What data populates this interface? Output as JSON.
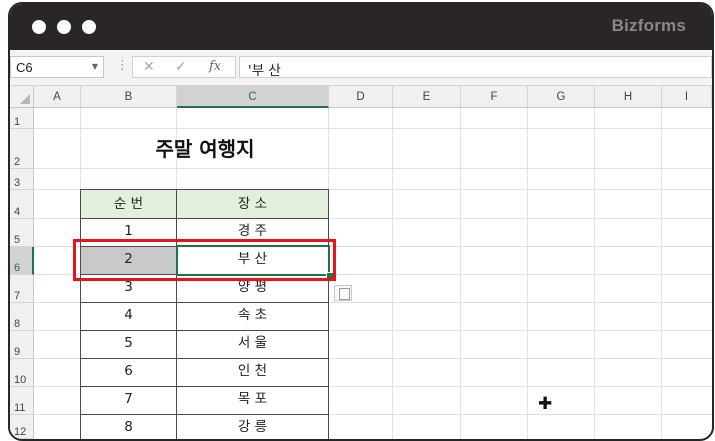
{
  "brand": "Bizforms",
  "formula_bar": {
    "name_box": "C6",
    "cancel_icon": "✕",
    "enter_icon": "✓",
    "fx_label": "fx",
    "formula": "'부 산"
  },
  "columns": [
    "A",
    "B",
    "C",
    "D",
    "E",
    "F",
    "G",
    "H",
    "I"
  ],
  "rows": [
    "1",
    "2",
    "3",
    "4",
    "5",
    "6",
    "7",
    "8",
    "9",
    "10",
    "11",
    "12"
  ],
  "sheet": {
    "title": "주말 여행지",
    "headers": [
      "순 번",
      "장 소"
    ],
    "rows": [
      {
        "num": "1",
        "place": "경 주"
      },
      {
        "num": "2",
        "place": "부 산"
      },
      {
        "num": "3",
        "place": "양 평"
      },
      {
        "num": "4",
        "place": "속 초"
      },
      {
        "num": "5",
        "place": "서 울"
      },
      {
        "num": "6",
        "place": "인 천"
      },
      {
        "num": "7",
        "place": "목 포"
      },
      {
        "num": "8",
        "place": "강 릉"
      }
    ]
  },
  "colors": {
    "accent_green": "#217346",
    "highlight_red": "#e8141c",
    "table_header_bg": "#e2efda",
    "titlebar": "#2a2527"
  },
  "icons": [
    "traffic-dot-icon",
    "dropdown-arrow-icon",
    "cancel-icon",
    "enter-icon",
    "fx-icon",
    "paste-options-icon",
    "cell-cursor-icon"
  ]
}
